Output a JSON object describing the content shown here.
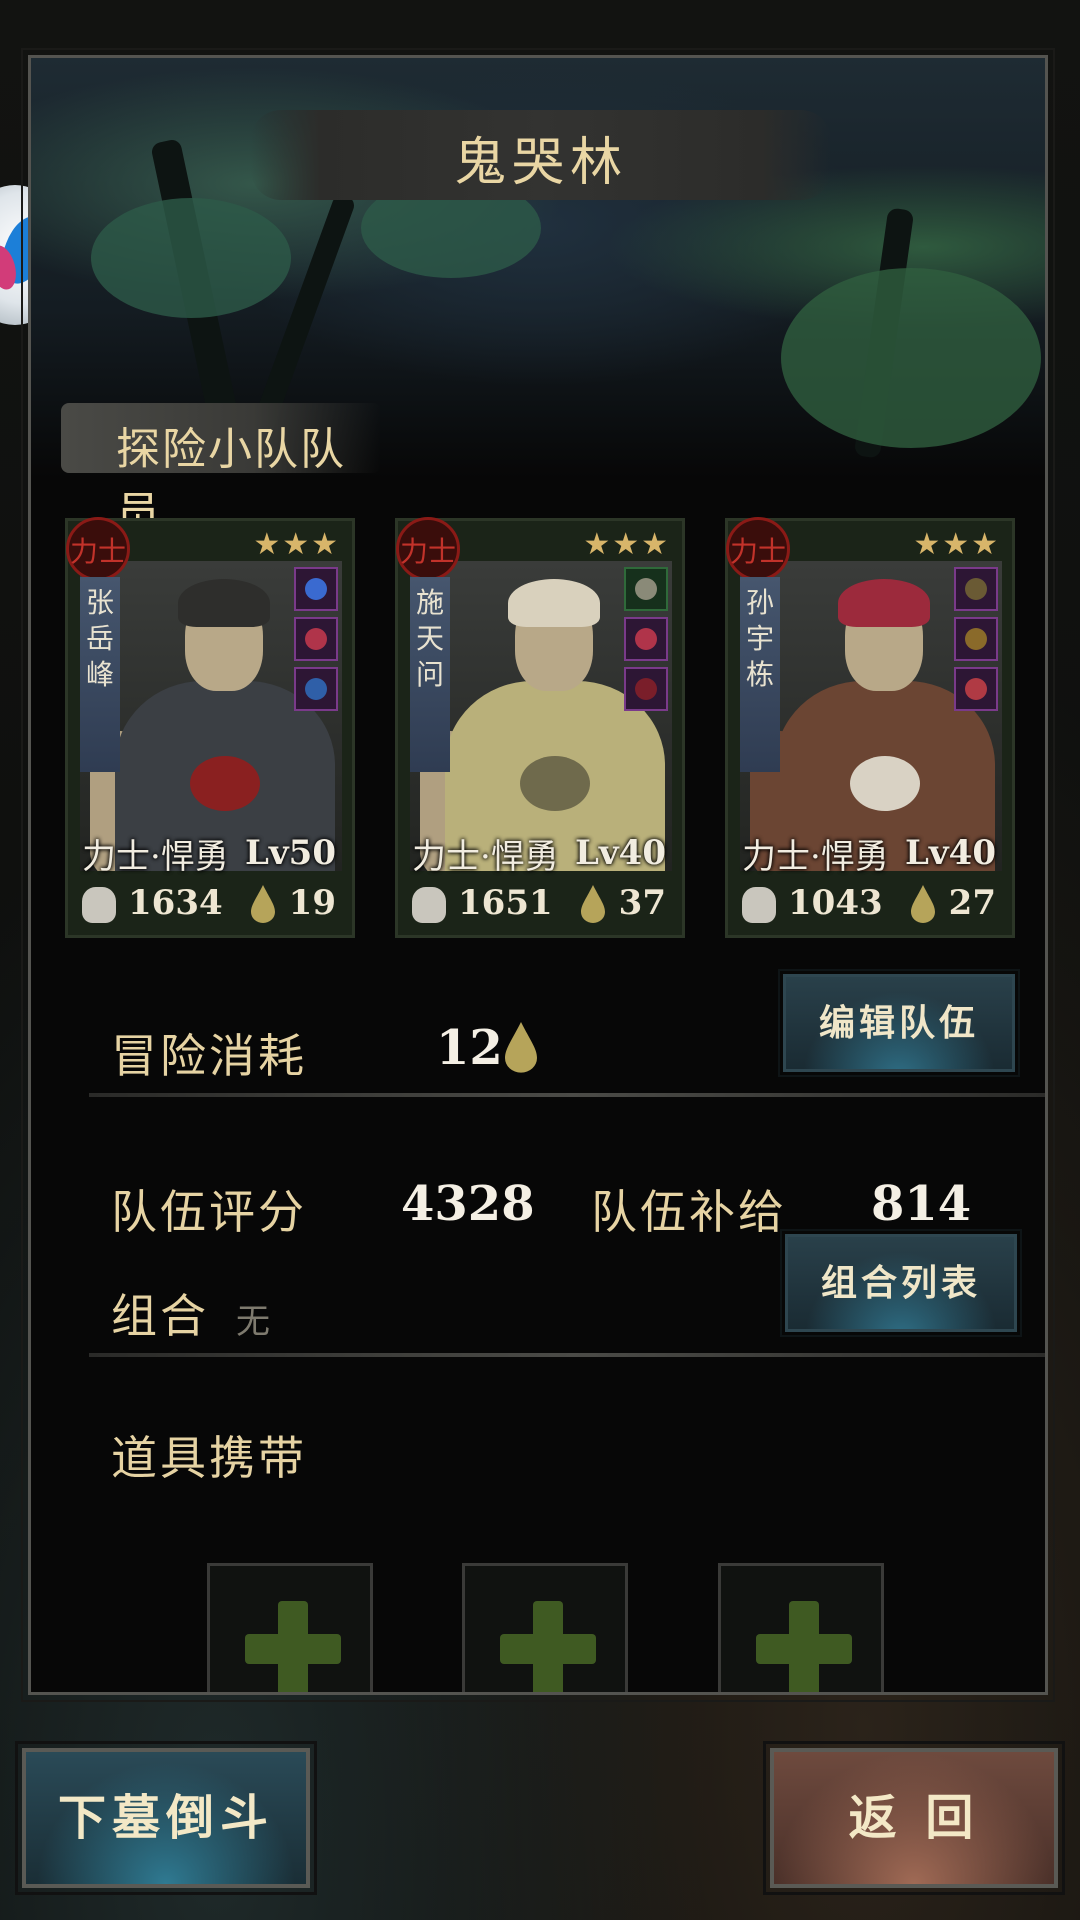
{
  "map_title": "鬼哭林",
  "section_title": "探险小队队员",
  "members": [
    {
      "badge": "力士",
      "stars": "★★★",
      "name_chars": [
        "张",
        "岳",
        "峰"
      ],
      "class_label": "力士·悍勇",
      "level": "Lv50",
      "power": "1634",
      "supply": "19",
      "hat_color": "#2e2e2c",
      "shirt_color": "#3b3f44",
      "mark_color": "#8a2020"
    },
    {
      "badge": "力士",
      "stars": "★★★",
      "name_chars": [
        "施",
        "天",
        "问"
      ],
      "class_label": "力士·悍勇",
      "level": "Lv40",
      "power": "1651",
      "supply": "37",
      "hat_color": "#d9d1bd",
      "shirt_color": "#b9b07a",
      "mark_color": "#6f6a4c"
    },
    {
      "badge": "力士",
      "stars": "★★★",
      "name_chars": [
        "孙",
        "宇",
        "栋"
      ],
      "class_label": "力士·悍勇",
      "level": "Lv40",
      "power": "1043",
      "supply": "27",
      "hat_color": "#9c2a3c",
      "shirt_color": "#6b4533",
      "mark_color": "#d9d2c4"
    }
  ],
  "adventure_cost": {
    "label": "冒险消耗",
    "value": "12"
  },
  "edit_team_button": "编辑队伍",
  "team_score": {
    "label": "队伍评分",
    "value": "4328"
  },
  "team_supply": {
    "label": "队伍补给",
    "value": "814"
  },
  "combo": {
    "label": "组合",
    "value": "无"
  },
  "combo_list_button": "组合列表",
  "items_carry": {
    "label": "道具携带"
  },
  "descend_button": "下墓倒斗",
  "return_button": "返 回",
  "icons": {
    "power": "fist-icon",
    "supply": "drop-icon",
    "add_slot": "plus-icon"
  }
}
